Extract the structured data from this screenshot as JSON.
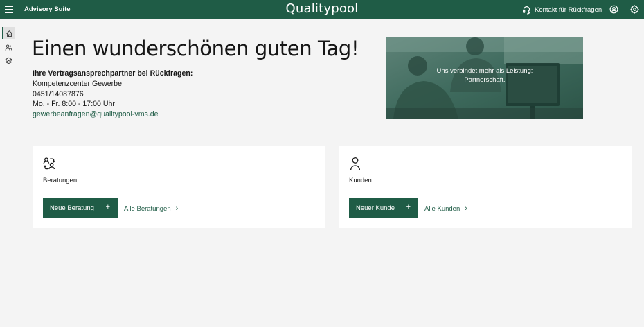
{
  "topbar": {
    "app_name": "Advisory Suite",
    "logo": "Qualitypool",
    "contact_label": "Kontakt für Rückfragen",
    "icons": [
      "menu-icon",
      "headset-icon",
      "user-profile-icon",
      "settings-gear-icon"
    ]
  },
  "sidenav": {
    "items": [
      {
        "icon": "home-icon",
        "active": true
      },
      {
        "icon": "users-icon",
        "active": false
      },
      {
        "icon": "layers-icon",
        "active": false
      }
    ]
  },
  "main": {
    "greeting": "Einen wunderschönen guten Tag!",
    "contact": {
      "heading": "Ihre Vertragsansprechpartner bei Rückfragen:",
      "name": "Kompetenzcenter Gewerbe",
      "phone": "0451/14087876",
      "hours": "Mo. - Fr. 8:00 - 17:00 Uhr",
      "email": "gewerbeanfragen@qualitypool-vms.de"
    },
    "banner": {
      "line1": "Uns verbindet mehr als Leistung:",
      "line2": "Partnerschaft."
    }
  },
  "cards": [
    {
      "title": "Beratungen",
      "icon": "consultation-exchange-icon",
      "primary_label": "Neue Beratung",
      "primary_symbol": "+",
      "link_label": "Alle Beratungen",
      "link_symbol": "›"
    },
    {
      "title": "Kunden",
      "icon": "person-icon",
      "primary_label": "Neuer Kunde",
      "primary_symbol": "+",
      "link_label": "Alle Kunden",
      "link_symbol": "›"
    }
  ],
  "colors": {
    "brand": "#1f5c46",
    "background": "#f4f4f4",
    "card": "#ffffff"
  }
}
